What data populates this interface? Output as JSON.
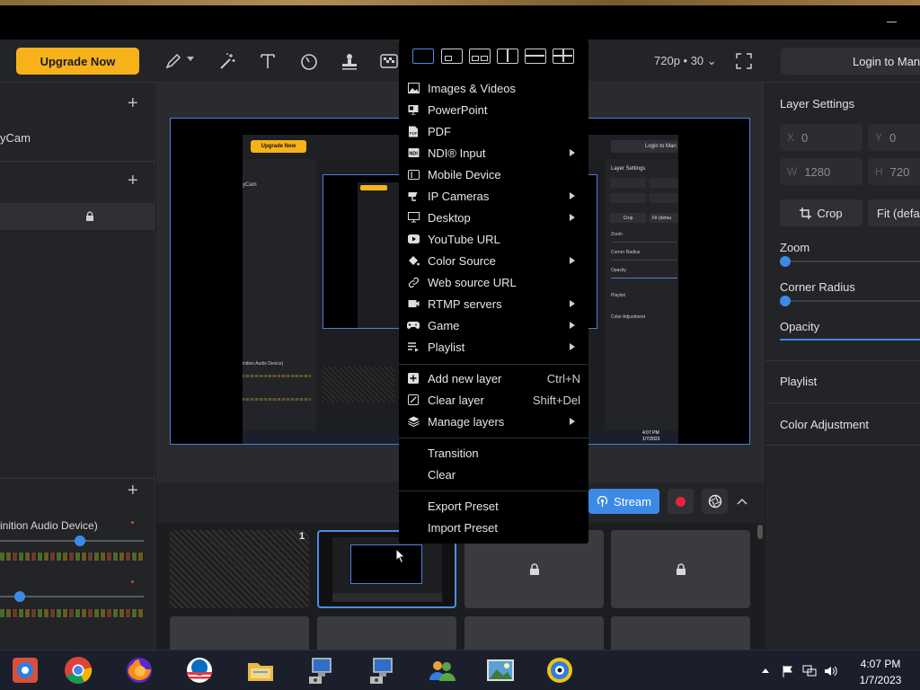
{
  "toolbar": {
    "upgrade_label": "Upgrade Now",
    "resolution": "720p • 30",
    "login_label": "Login to Man",
    "tools": [
      "pen-icon",
      "magic-wand-icon",
      "text-icon",
      "timer-icon",
      "stamp-icon",
      "checker-icon"
    ]
  },
  "left_panel": {
    "cam_label": "yCam",
    "audio_device": "inition Audio Device)"
  },
  "canvas": {
    "nested_upgrade": "Upgrade Now",
    "nested_login": "Login to Man",
    "nested_layer_settings": "Layer Settings",
    "nested_zoom": "Zoom",
    "nested_corner": "Corner Radius",
    "nested_opacity": "Opacity",
    "nested_playlist": "Playlist",
    "nested_color": "Color Adjustment",
    "nested_cam": "yCam",
    "nested_audio": "inition Audio Device)",
    "nested_time": "4:07 PM",
    "nested_date": "1/7/2023",
    "nested_crop": "Crop",
    "nested_fit": "Fit (defau"
  },
  "controls": {
    "stream_label": "Stream",
    "thumb_number": "1"
  },
  "right_panel": {
    "layer_settings": "Layer Settings",
    "x_label": "X",
    "x_value": "0",
    "y_label": "Y",
    "y_value": "0",
    "w_label": "W",
    "w_value": "1280",
    "h_label": "H",
    "h_value": "720",
    "crop_label": "Crop",
    "fit_label": "Fit (defau",
    "zoom_label": "Zoom",
    "corner_label": "Corner Radius",
    "opacity_label": "Opacity",
    "playlist_label": "Playlist",
    "color_label": "Color Adjustment"
  },
  "menu": {
    "layouts": [
      "layout-single",
      "layout-pip-corner",
      "layout-pip-bottom",
      "layout-split-vertical",
      "layout-split-horizontal",
      "layout-grid"
    ],
    "items": [
      {
        "label": "Images & Videos",
        "icon": "image-icon",
        "submenu": false,
        "shortcut": ""
      },
      {
        "label": "PowerPoint",
        "icon": "powerpoint-icon",
        "submenu": false,
        "shortcut": ""
      },
      {
        "label": "PDF",
        "icon": "pdf-icon",
        "submenu": false,
        "shortcut": ""
      },
      {
        "label": "NDI® Input",
        "icon": "ndi-icon",
        "submenu": true,
        "shortcut": ""
      },
      {
        "label": "Mobile Device",
        "icon": "mobile-icon",
        "submenu": false,
        "shortcut": ""
      },
      {
        "label": "IP Cameras",
        "icon": "ip-camera-icon",
        "submenu": true,
        "shortcut": ""
      },
      {
        "label": "Desktop",
        "icon": "desktop-icon",
        "submenu": true,
        "shortcut": ""
      },
      {
        "label": "YouTube URL",
        "icon": "youtube-icon",
        "submenu": false,
        "shortcut": ""
      },
      {
        "label": "Color Source",
        "icon": "paint-bucket-icon",
        "submenu": true,
        "shortcut": ""
      },
      {
        "label": "Web source URL",
        "icon": "link-icon",
        "submenu": false,
        "shortcut": ""
      },
      {
        "label": "RTMP servers",
        "icon": "rtmp-icon",
        "submenu": true,
        "shortcut": ""
      },
      {
        "label": "Game",
        "icon": "gamepad-icon",
        "submenu": true,
        "shortcut": ""
      },
      {
        "label": "Playlist",
        "icon": "playlist-icon",
        "submenu": true,
        "shortcut": ""
      }
    ],
    "layer_items": [
      {
        "label": "Add new layer",
        "icon": "add-layer-icon",
        "submenu": false,
        "shortcut": "Ctrl+N"
      },
      {
        "label": "Clear layer",
        "icon": "clear-layer-icon",
        "submenu": false,
        "shortcut": "Shift+Del"
      },
      {
        "label": "Manage layers",
        "icon": "layers-icon",
        "submenu": true,
        "shortcut": ""
      }
    ],
    "misc_items": [
      {
        "label": "Transition"
      },
      {
        "label": "Clear"
      }
    ],
    "preset_items": [
      {
        "label": "Export Preset"
      },
      {
        "label": "Import Preset"
      }
    ]
  },
  "taskbar": {
    "time": "4:07 PM",
    "date": "1/7/2023",
    "apps": [
      "media-app-icon",
      "chrome-icon",
      "firefox-icon",
      "obama-logo-icon",
      "file-explorer-icon",
      "network-computer-icon",
      "network-computer-2-icon",
      "users-icon",
      "photo-viewer-icon",
      "webcam-app-icon"
    ]
  },
  "colors": {
    "accent": "#3c8ae8",
    "upgrade": "#f7b21b",
    "record": "#e32636"
  }
}
